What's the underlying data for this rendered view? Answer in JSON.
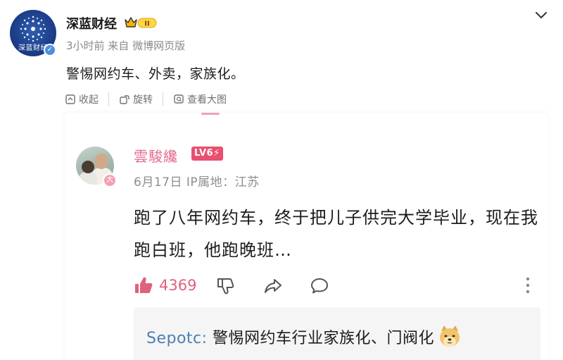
{
  "post": {
    "author": "深蓝财经",
    "avatar_caption": "深蓝财经",
    "meta": "3小时前  来自 微博网页版",
    "text": "警惕网约车、外卖，家族化。",
    "badge_level": "II"
  },
  "toolbar": {
    "collapse_label": "收起",
    "rotate_label": "旋转",
    "view_large_label": "查看大图"
  },
  "comment": {
    "username": "雲駿纔",
    "level_badge": "LV6⚡",
    "avatar_badge": "大",
    "meta": "6月17日 IP属地：江苏",
    "text": "跑了八年网约车，终于把儿子供完大学毕业，现在我跑白班，他跑晚班…",
    "likes": "4369"
  },
  "reply": {
    "user": "Sepotc:",
    "text": " 警惕网约车行业家族化、门阀化"
  },
  "colors": {
    "accent_pink": "#e0607f",
    "link_blue": "#4a7fb5",
    "verified_blue": "#4a90e2"
  },
  "icons": [
    "chevron-down-icon",
    "collapse-icon",
    "rotate-icon",
    "zoom-icon",
    "thumbs-up-icon",
    "thumbs-down-icon",
    "share-icon",
    "comment-icon",
    "more-icon",
    "doge-emoji-icon"
  ]
}
